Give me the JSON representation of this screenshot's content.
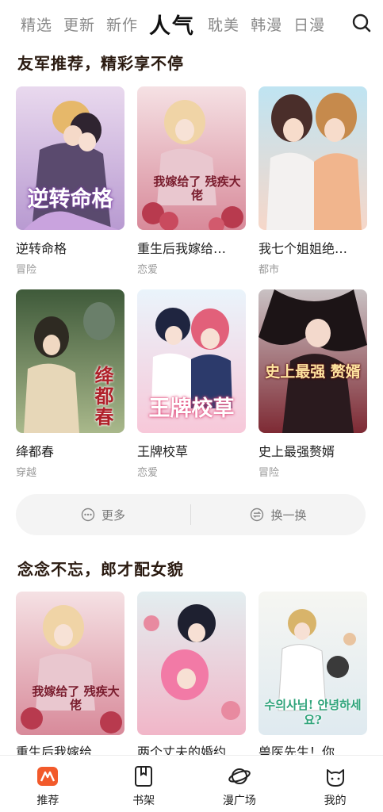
{
  "top_tabs": [
    "精选",
    "更新",
    "新作",
    "人气",
    "耽美",
    "韩漫",
    "日漫"
  ],
  "active_tab": "人气",
  "section1": {
    "title": "友军推荐，精彩享不停",
    "items": [
      {
        "title": "逆转命格",
        "genre": "冒险",
        "cover_text": "逆转命格"
      },
      {
        "title": "重生后我嫁给…",
        "genre": "恋爱",
        "cover_text": "我嫁给了 残疾大佬"
      },
      {
        "title": "我七个姐姐绝…",
        "genre": "都市",
        "cover_text": ""
      },
      {
        "title": "绛都春",
        "genre": "穿越",
        "cover_text": "绛都春"
      },
      {
        "title": "王牌校草",
        "genre": "恋爱",
        "cover_text": "王牌校草"
      },
      {
        "title": "史上最强赘婿",
        "genre": "冒险",
        "cover_text": "史上最强 赘婿"
      }
    ]
  },
  "actions": {
    "more": "更多",
    "refresh": "换一换"
  },
  "section2": {
    "title": "念念不忘，郎才配女貌",
    "items": [
      {
        "title": "重生后我嫁给…",
        "genre": "",
        "cover_text": "我嫁给了 残疾大佬"
      },
      {
        "title": "两个丈夫的婚约",
        "genre": "",
        "cover_text": ""
      },
      {
        "title": "兽医先生！你…",
        "genre": "",
        "cover_text": "수의사님! 안녕하세요?"
      }
    ]
  },
  "bottom_nav": [
    {
      "label": "推荐",
      "icon": "recommend-icon"
    },
    {
      "label": "书架",
      "icon": "bookshelf-icon"
    },
    {
      "label": "漫广场",
      "icon": "planet-icon"
    },
    {
      "label": "我的",
      "icon": "profile-cat-icon"
    }
  ],
  "colors": {
    "accent": "#f25a2b",
    "heading_highlight": "#f7cdb0",
    "muted": "#9a9a9a"
  }
}
